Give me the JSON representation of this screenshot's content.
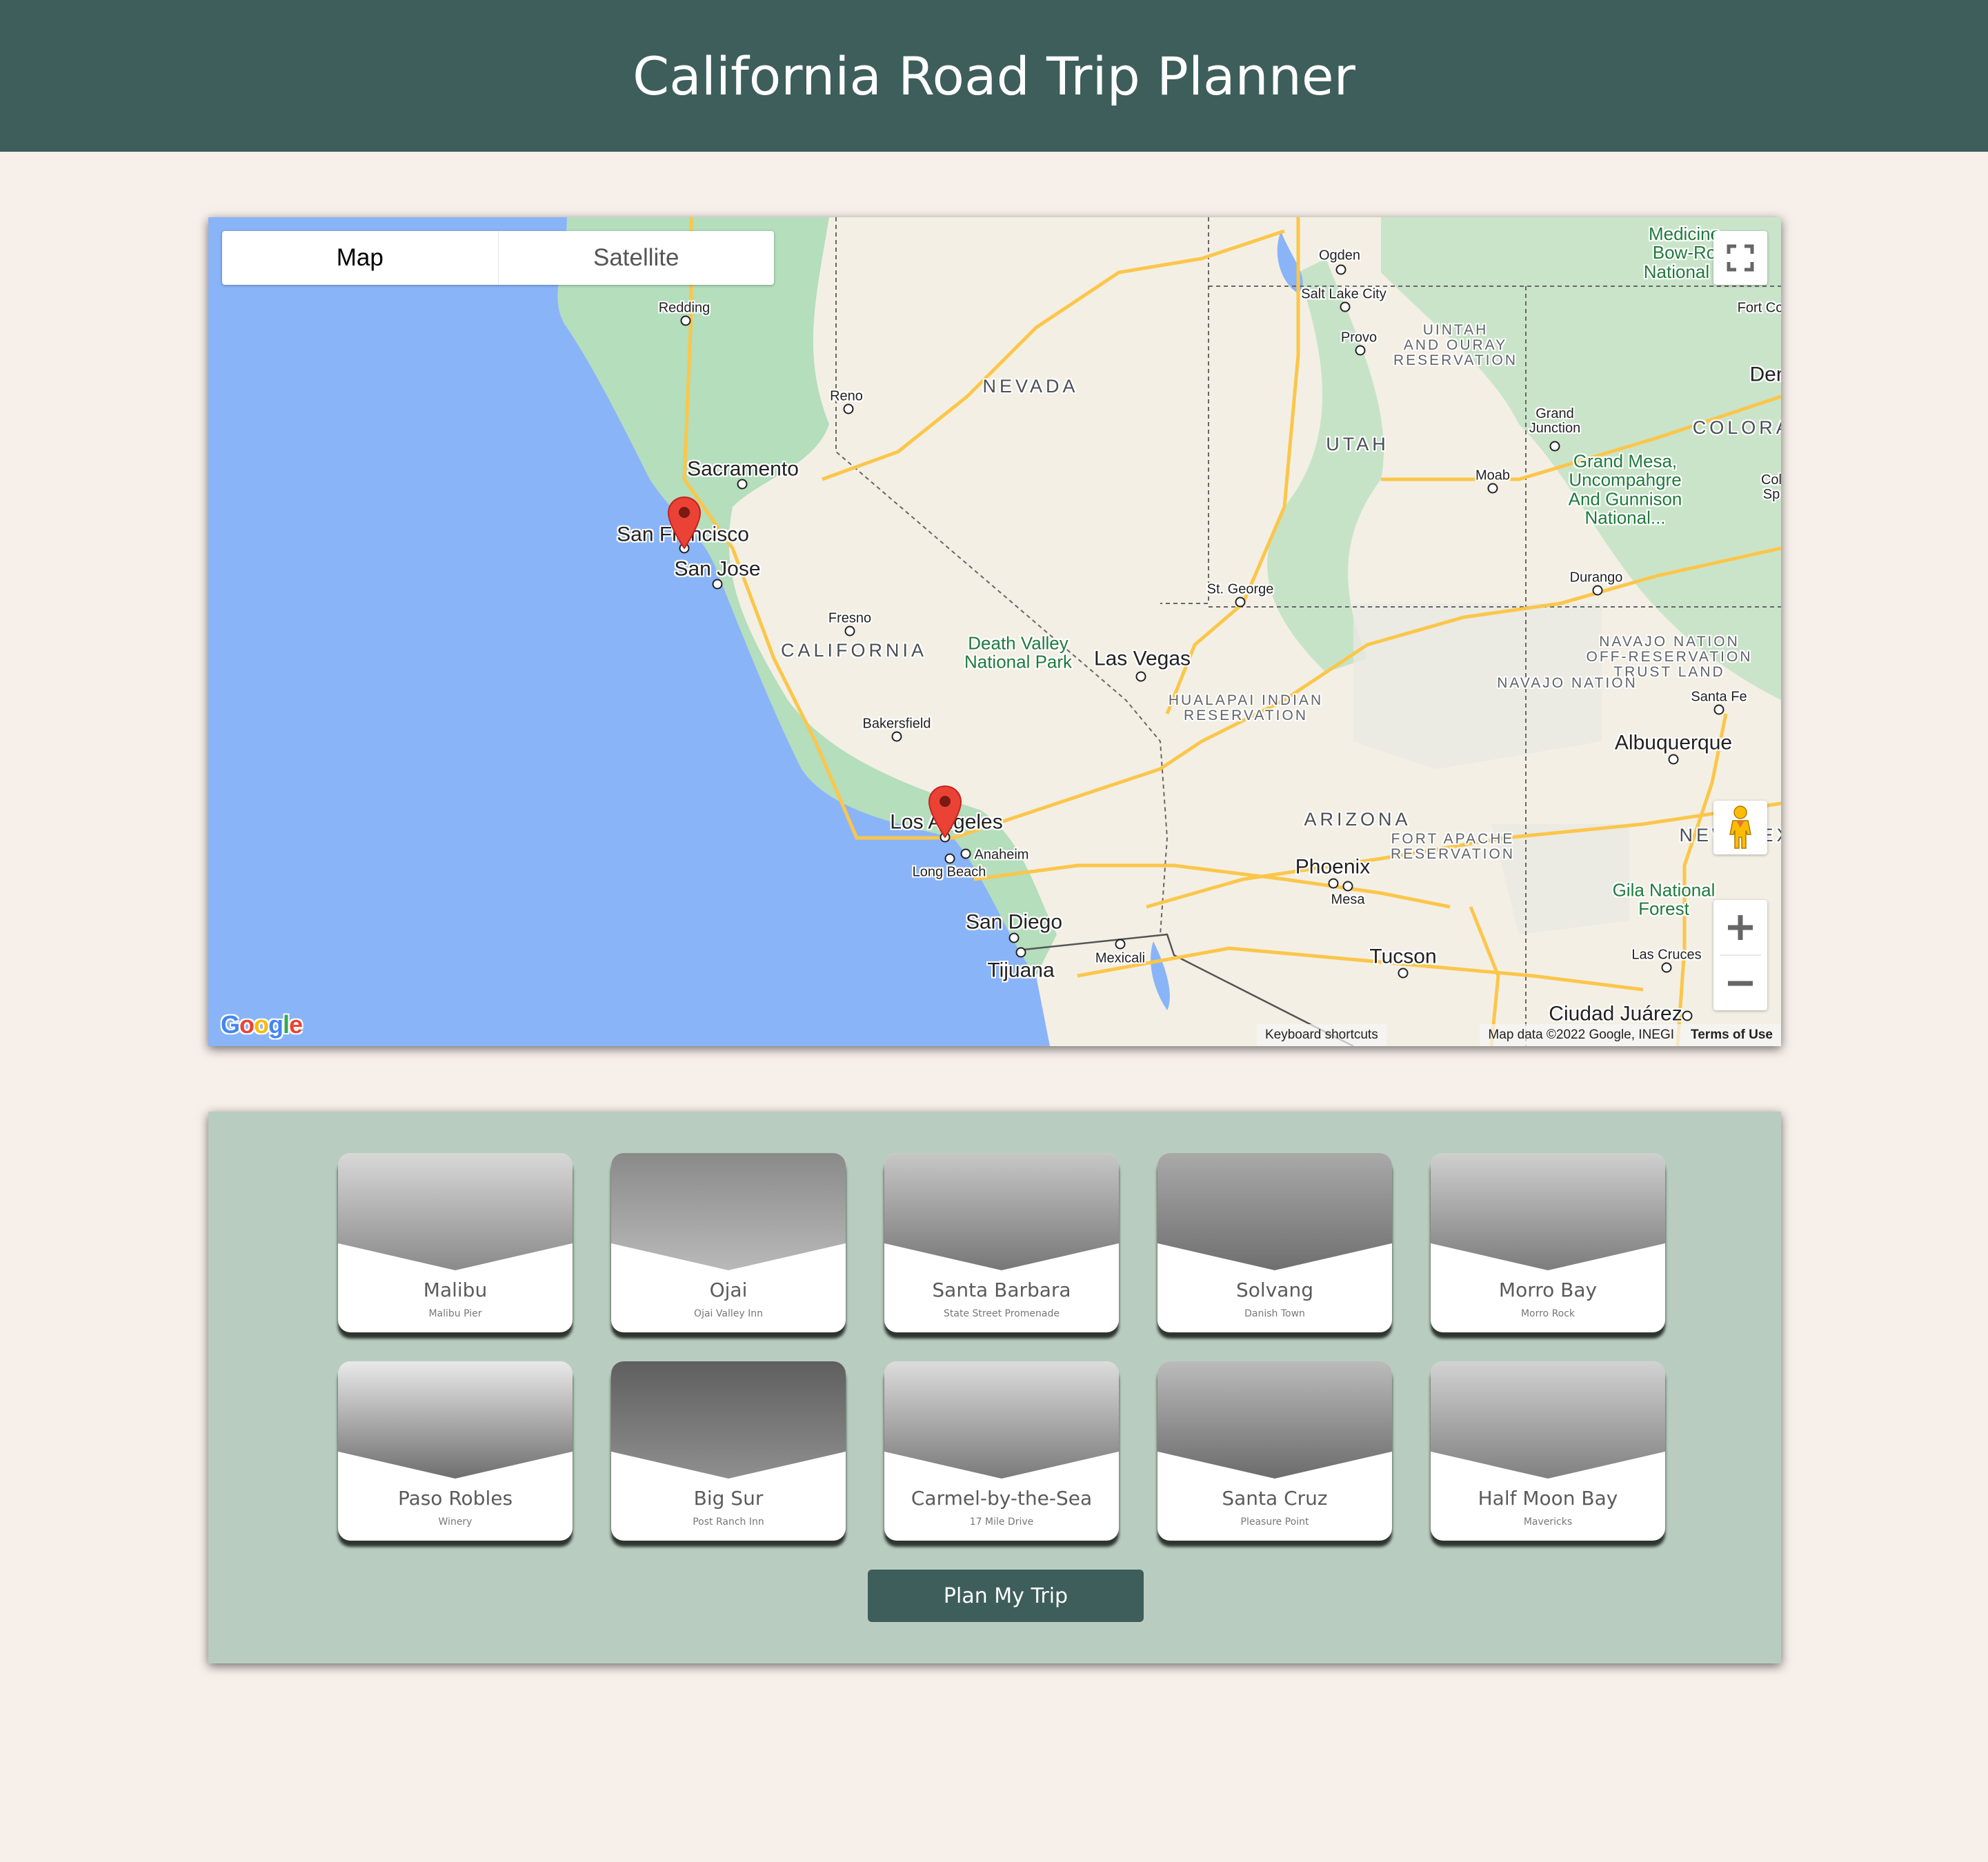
{
  "header": {
    "title": "California Road Trip Planner"
  },
  "map": {
    "map_type_options": [
      "Map",
      "Satellite"
    ],
    "selected_map_type": "Map",
    "controls": {
      "fullscreen": "fullscreen-toggle",
      "street_view": "pegman",
      "zoom_in": "+",
      "zoom_out": "−"
    },
    "attribution": {
      "keyboard_shortcuts": "Keyboard shortcuts",
      "map_data": "Map data ©2022 Google, INEGI",
      "terms": "Terms of Use"
    },
    "logo": [
      "G",
      "o",
      "o",
      "g",
      "l",
      "e"
    ],
    "markers": [
      "San Francisco",
      "Los Angeles"
    ],
    "labels": {
      "redding": "Redding",
      "reno": "Reno",
      "nevada": "NEVADA",
      "sacramento": "Sacramento",
      "san_francisco": "San Francisco",
      "san_jose": "San Jose",
      "fresno": "Fresno",
      "california": "CALIFORNIA",
      "death_valley": "Death Valley\nNational Park",
      "las_vegas": "Las Vegas",
      "bakersfield": "Bakersfield",
      "los_angeles": "Los Angeles",
      "anaheim": "Anaheim",
      "long_beach": "Long Beach",
      "san_diego": "San Diego",
      "tijuana": "Tijuana",
      "mexicali": "Mexicali",
      "hualapai": "HUALAPAI INDIAN\nRESERVATION",
      "ogden": "Ogden",
      "salt_lake_city": "Salt Lake City",
      "provo": "Provo",
      "uintah": "UINTAH\nAND OURAY\nRESERVATION",
      "utah": "UTAH",
      "grand_junction": "Grand\nJunction",
      "moab": "Moab",
      "grand_mesa": "Grand Mesa,\nUncompahgre\nAnd Gunnison\nNational...",
      "medicine_bow": "Medicine\nBow-Ro\nNational F",
      "fort_collins": "Fort Co",
      "denver": "Den",
      "colorado": "COLORAD",
      "colorado_springs": "Col\nSp",
      "st_george": "St. George",
      "durango": "Durango",
      "navajo_trust": "NAVAJO NATION\nOFF-RESERVATION\nTRUST LAND",
      "navajo": "NAVAJO NATION",
      "santa_fe": "Santa Fe",
      "albuquerque": "Albuquerque",
      "arizona": "ARIZONA",
      "fort_apache": "FORT APACHE\nRESERVATION",
      "new_mexico": "NEW MEXICO",
      "phoenix": "Phoenix",
      "mesa": "Mesa",
      "gila": "Gila National\nForest",
      "tucson": "Tucson",
      "las_cruces": "Las Cruces",
      "ciudad_juarez": "Ciudad Juárez"
    }
  },
  "destinations": [
    {
      "title": "Malibu",
      "subtitle": "Malibu Pier"
    },
    {
      "title": "Ojai",
      "subtitle": "Ojai Valley Inn"
    },
    {
      "title": "Santa Barbara",
      "subtitle": "State Street Promenade"
    },
    {
      "title": "Solvang",
      "subtitle": "Danish Town"
    },
    {
      "title": "Morro Bay",
      "subtitle": "Morro Rock"
    },
    {
      "title": "Paso Robles",
      "subtitle": "Winery"
    },
    {
      "title": "Big Sur",
      "subtitle": "Post Ranch Inn"
    },
    {
      "title": "Carmel-by-the-Sea",
      "subtitle": "17 Mile Drive"
    },
    {
      "title": "Santa Cruz",
      "subtitle": "Pleasure Point"
    },
    {
      "title": "Half Moon Bay",
      "subtitle": "Mavericks"
    }
  ],
  "actions": {
    "plan_trip": "Plan My Trip"
  },
  "colors": {
    "header_bg": "#3d5e5b",
    "page_bg": "#f7efea",
    "panel_bg": "#b8cdc0",
    "button_bg": "#3d5e5b",
    "marker": "#ea4335"
  }
}
